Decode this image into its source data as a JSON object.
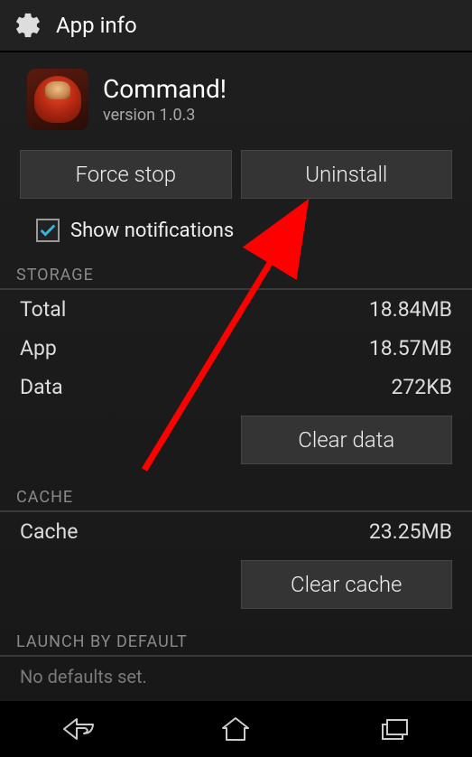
{
  "header": {
    "title": "App info"
  },
  "app": {
    "name": "Command!",
    "version_label": "version 1.0.3"
  },
  "buttons": {
    "force_stop": "Force stop",
    "uninstall": "Uninstall",
    "clear_data": "Clear data",
    "clear_cache": "Clear cache"
  },
  "checkbox": {
    "show_notifications": "Show notifications",
    "checked": true
  },
  "sections": {
    "storage": "STORAGE",
    "cache": "CACHE",
    "launch": "LAUNCH BY DEFAULT"
  },
  "storage": {
    "total_label": "Total",
    "total_value": "18.84MB",
    "app_label": "App",
    "app_value": "18.57MB",
    "data_label": "Data",
    "data_value": "272KB"
  },
  "cache": {
    "label": "Cache",
    "value": "23.25MB"
  },
  "launch": {
    "defaults_text": "No defaults set."
  },
  "colors": {
    "accent_check": "#34b5e2",
    "arrow": "#ff0000"
  }
}
